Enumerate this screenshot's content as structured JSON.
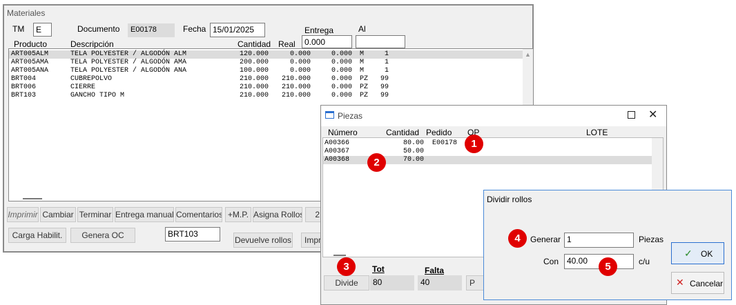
{
  "materiales": {
    "title": "Materiales",
    "tm_label": "TM",
    "tm_value": "E",
    "documento_label": "Documento",
    "documento_value": "E00178",
    "fecha_label": "Fecha",
    "fecha_value": "15/01/2025",
    "entrega_label": "Entrega",
    "entrega_value": "0.000",
    "al_label": "Al",
    "al_value": "",
    "columns": [
      "Producto",
      "Descripción",
      "Cantidad",
      "Real"
    ],
    "rows": [
      {
        "producto": "ART005ALM",
        "descripcion": "TELA POLYESTER / ALGODÓN ALM",
        "cantidad": "120.000",
        "real": "0.000",
        "c5": "0.000",
        "c6": "M",
        "c7": "1"
      },
      {
        "producto": "ART005AMA",
        "descripcion": "TELA POLYESTER / ALGODÓN AMA",
        "cantidad": "200.000",
        "real": "0.000",
        "c5": "0.000",
        "c6": "M",
        "c7": "1"
      },
      {
        "producto": "ART005ANA",
        "descripcion": "TELA POLYESTER / ALGODÓN ANA",
        "cantidad": "100.000",
        "real": "0.000",
        "c5": "0.000",
        "c6": "M",
        "c7": "1"
      },
      {
        "producto": "BRT004",
        "descripcion": "CUBREPOLVO",
        "cantidad": "210.000",
        "real": "210.000",
        "c5": "0.000",
        "c6": "PZ",
        "c7": "99"
      },
      {
        "producto": "BRT006",
        "descripcion": "CIERRE",
        "cantidad": "210.000",
        "real": "210.000",
        "c5": "0.000",
        "c6": "PZ",
        "c7": "99"
      },
      {
        "producto": "BRT103",
        "descripcion": "GANCHO TIPO M",
        "cantidad": "210.000",
        "real": "210.000",
        "c5": "0.000",
        "c6": "PZ",
        "c7": "99"
      }
    ],
    "buttons": {
      "imprimir": "Imprimir",
      "cambiar": "Cambiar",
      "terminar": "Terminar",
      "entrega_manual": "Entrega manual",
      "comentarios": "Comentarios",
      "mp": "+M.P.",
      "asigna_rollos": "Asigna Rollos",
      "partial2": "2",
      "carga_habilit": "Carga Habilit.",
      "genera_oc": "Genera OC",
      "devuelve_rollos": "Devuelve rollos",
      "impr_partial": "Impr"
    },
    "producto_field": "BRT103"
  },
  "piezas": {
    "title": "Piezas",
    "columns": [
      "Número",
      "Cantidad",
      "Pedido",
      "OP",
      "LOTE"
    ],
    "rows": [
      {
        "numero": "A00366",
        "cantidad": "80.00",
        "pedido": "E00178"
      },
      {
        "numero": "A00367",
        "cantidad": "50.00",
        "pedido": ""
      },
      {
        "numero": "A00368",
        "cantidad": "70.00",
        "pedido": ""
      }
    ],
    "divide_label": "Divide",
    "tot_label": "Tot",
    "tot_value": "80",
    "falta_label": "Falta",
    "falta_value": "40",
    "partial_button": "P"
  },
  "dividir": {
    "title": "Dividir rollos",
    "generar_label": "Generar",
    "generar_value": "1",
    "piezas_label": "Piezas",
    "con_label": "Con",
    "con_value": "40.00",
    "cu_label": "c/u",
    "ok_label": "OK",
    "cancelar_label": "Cancelar"
  },
  "markers": [
    "1",
    "2",
    "3",
    "4",
    "5"
  ],
  "colors": {
    "marker": "#e00000",
    "ok_check": "#2a8a2a",
    "cancel_x": "#d02020",
    "ok_border": "#2a6fd0"
  }
}
